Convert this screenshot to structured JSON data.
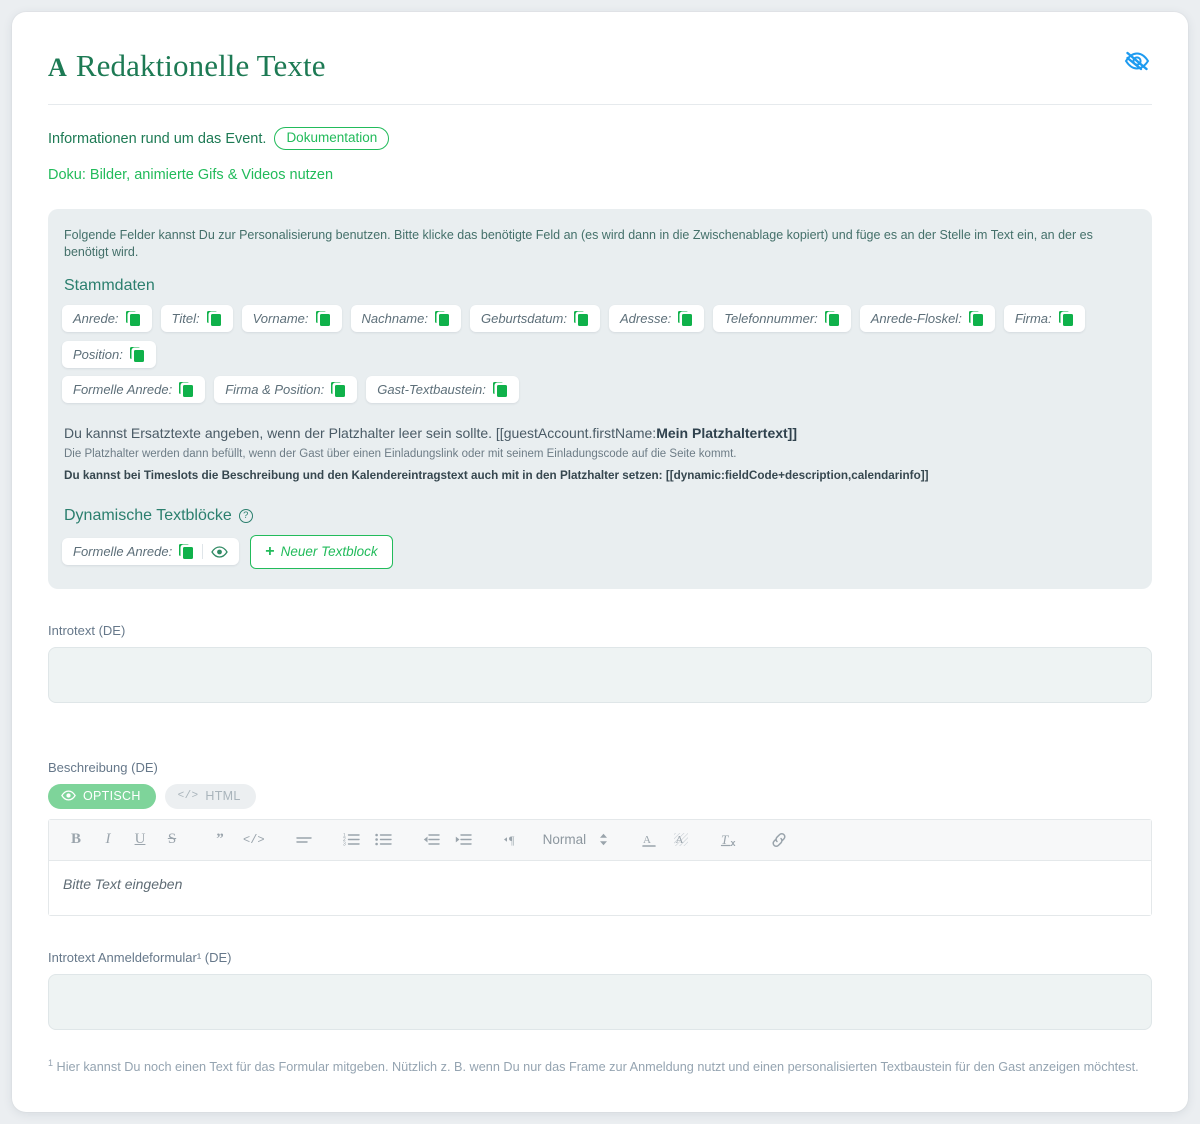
{
  "header": {
    "glyph": "A",
    "title": "Redaktionelle Texte",
    "visibility_icon": "eye-off-icon"
  },
  "intro": {
    "text": "Informationen rund um das Event.",
    "badge": "Dokumentation",
    "doku_link": "Doku: Bilder, animierte Gifs & Videos nutzen"
  },
  "panel": {
    "hint": "Folgende Felder kannst Du zur Personalisierung benutzen. Bitte klicke das benötigte Feld an (es wird dann in die Zwischenablage kopiert) und füge es an der Stelle im Text ein, an der es benötigt wird.",
    "stammdaten_title": "Stammdaten",
    "chips_row1": [
      "Anrede:",
      "Titel:",
      "Vorname:",
      "Nachname:",
      "Geburtsdatum:",
      "Adresse:",
      "Telefonnummer:",
      "Anrede-Floskel:",
      "Firma:",
      "Position:"
    ],
    "chips_row2": [
      "Formelle Anrede:",
      "Firma & Position:",
      "Gast-Textbaustein:"
    ],
    "placeholder_info": {
      "line1_normal": "Du kannst Ersatztexte angeben, wenn der Platzhalter leer sein sollte. [[guestAccount.firstName:",
      "line1_bold": "Mein Platzhaltertext]]",
      "line2": "Die Platzhalter werden dann befüllt, wenn der Gast über einen Einladungslink oder mit seinem Einladungscode auf die Seite kommt.",
      "line3": "Du kannst bei Timeslots die Beschreibung und den Kalendereintragstext auch mit in den Platzhalter setzen: [[dynamic:fieldCode+description,calendarinfo]]"
    },
    "dynamic_title": "Dynamische Textblöcke",
    "dynamic_help_icon": "question-mark-icon",
    "dynamic_chip": "Formelle Anrede:",
    "new_block_button": "Neuer Textblock"
  },
  "fields": {
    "introtext": {
      "label": "Introtext (DE)",
      "value": "",
      "placeholder": ""
    },
    "beschreibung": {
      "label": "Beschreibung (DE)",
      "toggle_optisch": "OPTISCH",
      "toggle_html": "HTML",
      "editor_placeholder": "Bitte Text eingeben"
    },
    "introtext_anmeldeformular": {
      "label": "Introtext Anmeldeformular¹ (DE)",
      "value": "",
      "placeholder": ""
    }
  },
  "editor_toolbar": {
    "bold": "B",
    "italic": "I",
    "underline": "U",
    "strike": "S",
    "blockquote": "”",
    "code": "</>",
    "format_select": "Normal"
  },
  "footnote": {
    "marker": "1",
    "text": "Hier kannst Du noch einen Text für das Formular mitgeben. Nützlich z. B. wenn Du nur das Frame zur Anmeldung nutzt und einen personalisierten Textbaustein für den Gast anzeigen möchtest."
  },
  "colors": {
    "brand_green": "#1d7a54",
    "accent_green": "#22bb5b",
    "copy_icon_green": "#0fb14a",
    "eye_off_blue": "#1e9bf0",
    "panel_bg": "#e9eef0"
  }
}
